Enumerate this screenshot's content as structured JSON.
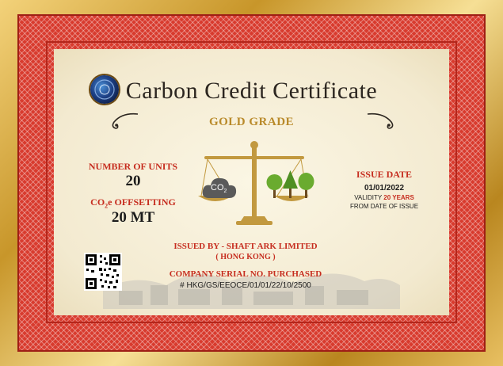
{
  "certificate": {
    "title": "Carbon Credit Certificate",
    "grade": "GOLD GRADE",
    "units_label": "NUMBER OF UNITS",
    "units_value": "20",
    "offset_label_pre": "CO",
    "offset_label_sub": "2",
    "offset_label_post": "e OFFSETTING",
    "offset_value": "20 MT",
    "issue_date_label": "ISSUE DATE",
    "issue_date_value": "01/01/2022",
    "validity_pre": "VALIDITY ",
    "validity_years": "20 YEARS",
    "validity_line2": "FROM DATE OF ISSUE",
    "issuer_line1": "ISSUED BY - SHAFT ARK LIMITED",
    "issuer_line2": "( HONG KONG )",
    "serial_label": "COMPANY SERIAL NO. PURCHASED",
    "serial_value": "# HKG/GS/EEOCE/01/01/22/10/2500",
    "co2_icon_text": "CO",
    "co2_icon_sub": "2"
  },
  "colors": {
    "gold_frame": "#c8962a",
    "red_border": "#d83b2e",
    "heading_red": "#c62d1f",
    "grade_gold": "#b98a2a",
    "tree_green": "#6aab2f",
    "cloud_gray": "#5a5a5a",
    "scale_gold": "#c2993f"
  },
  "icons": [
    "seal-icon",
    "scale-icon",
    "co2-cloud-icon",
    "trees-icon",
    "qr-code-icon",
    "ornament-icon"
  ]
}
